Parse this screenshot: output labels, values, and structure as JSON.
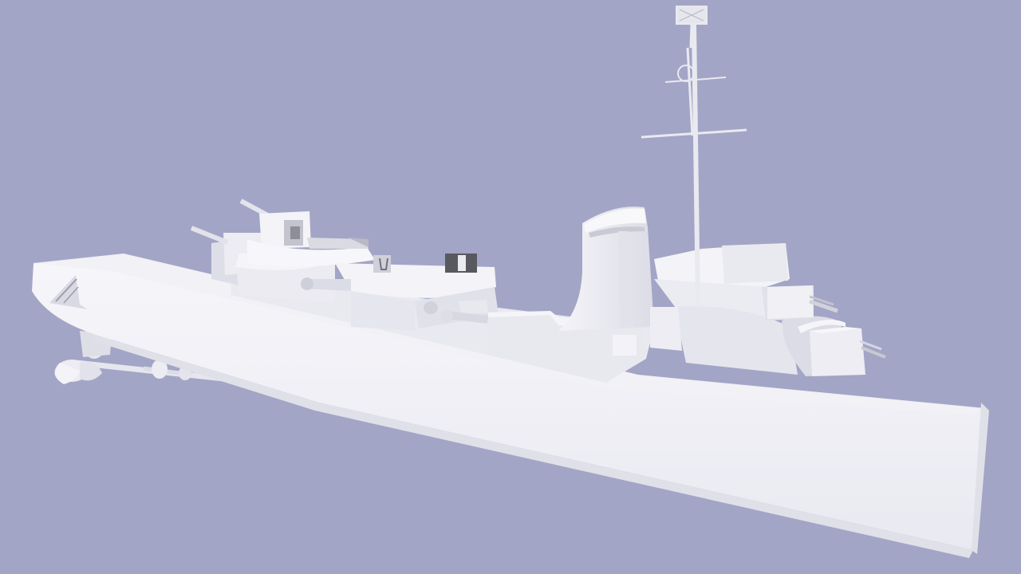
{
  "scene": {
    "subject": "ship-model-render",
    "colors": {
      "background": "#a3a5c6",
      "hull": "#f3f3f8",
      "hull_shade": "#e4e4ec",
      "deck": "#ececf2",
      "superstructure": "#eeeef4",
      "shadow": "#d6d6e0",
      "dark": "#6a6a72",
      "line": "#c9c9d4"
    }
  }
}
